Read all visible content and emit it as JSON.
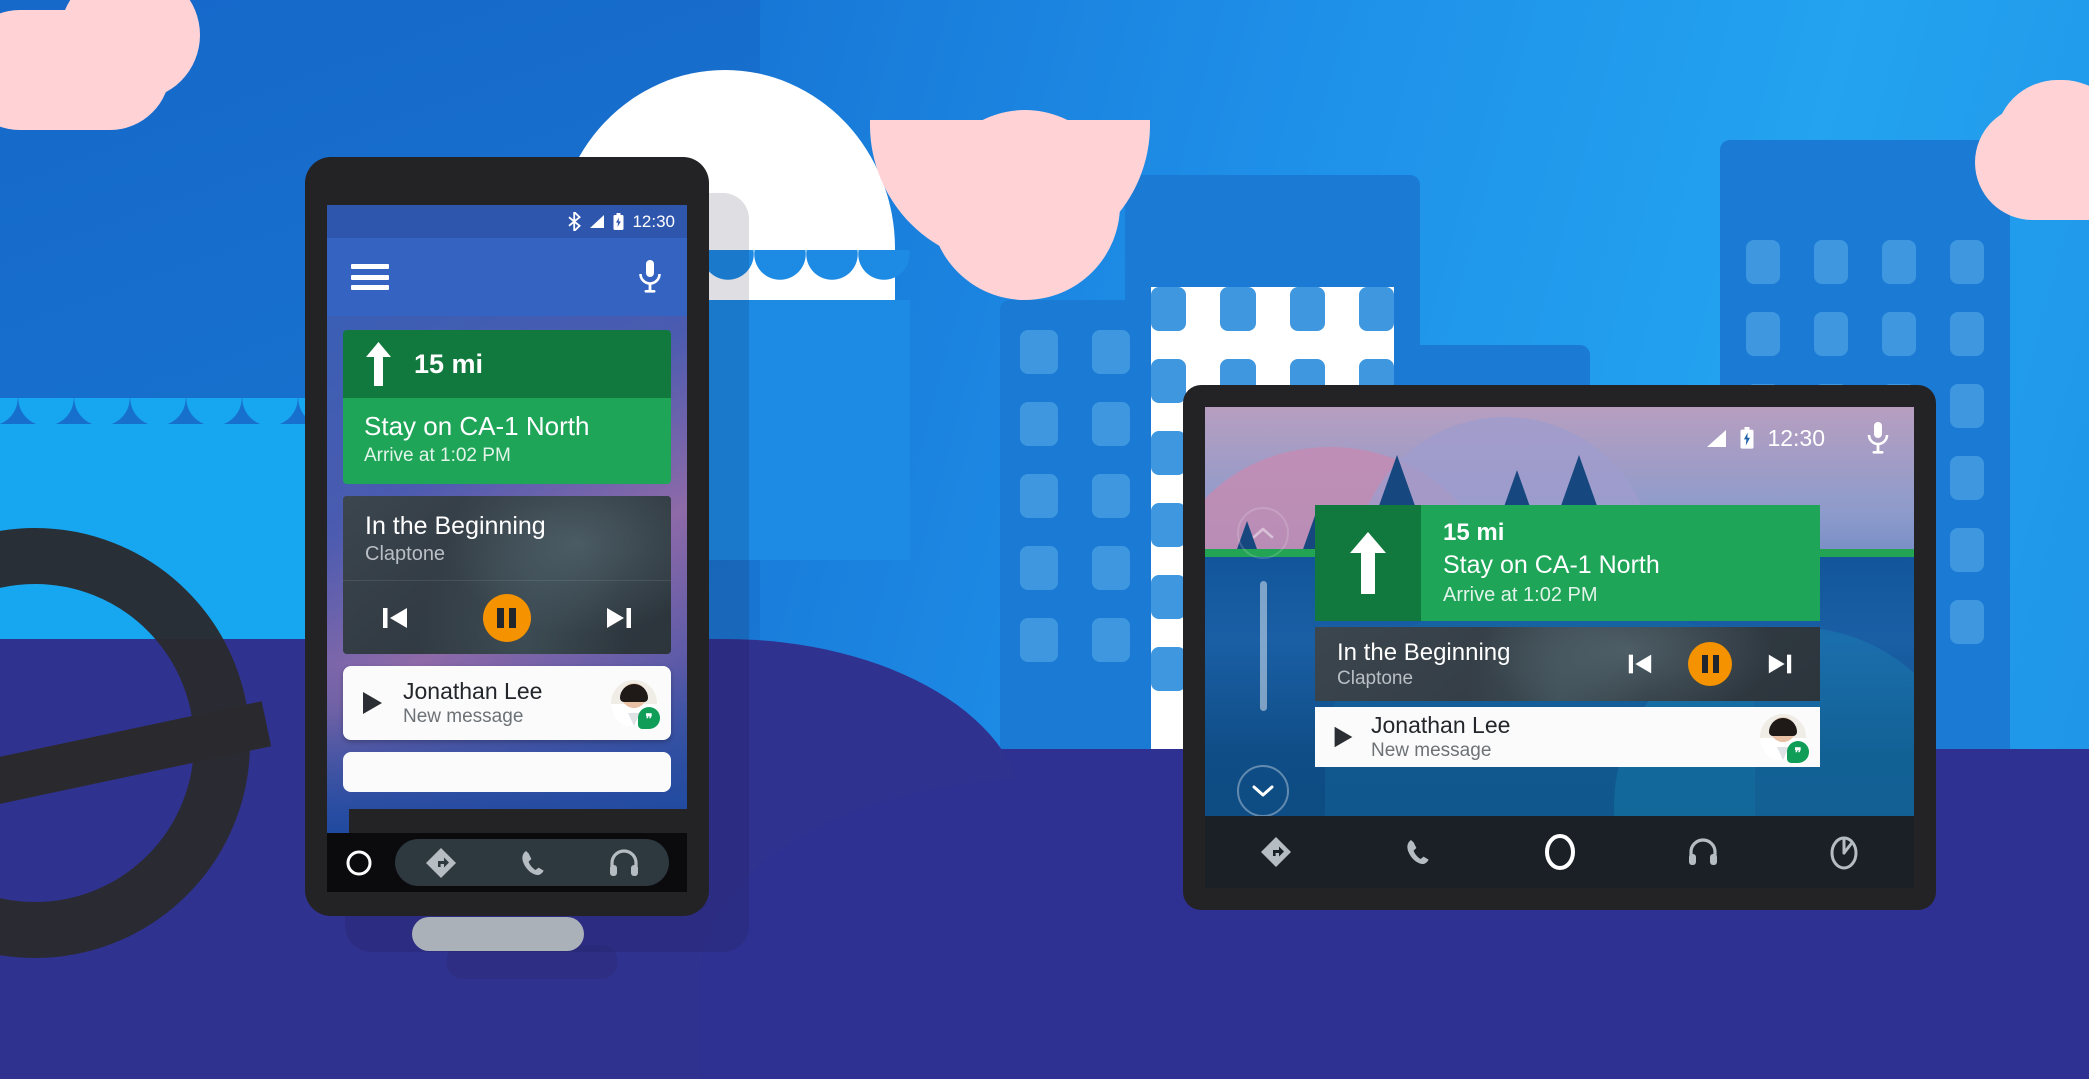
{
  "scene": {
    "title": "Android Auto on phone screen and car head unit",
    "colors": {
      "sky_blue": "#1e8fe8",
      "ground_navy": "#2f3192",
      "cloud_pink": "#ffd3d6",
      "nav_green_dark": "#12793e",
      "nav_green_light": "#1ea558",
      "media_gray": "#3c464e",
      "accent_orange": "#f59200",
      "hangouts_green": "#0f9d58",
      "phone_header_blue": "#3463c1"
    }
  },
  "phone": {
    "status_bar": {
      "bluetooth_icon": "bluetooth-icon",
      "signal_icon": "signal-icon",
      "battery_icon": "battery-icon",
      "time": "12:30"
    },
    "app_bar": {
      "menu_icon": "hamburger-menu-icon",
      "mic_icon": "microphone-icon"
    },
    "nav_card": {
      "maneuver_icon": "straight-arrow-icon",
      "distance": "15 mi",
      "instruction": "Stay on CA-1 North",
      "eta": "Arrive at 1:02 PM"
    },
    "media_card": {
      "track_title": "In the Beginning",
      "artist": "Claptone",
      "prev_icon": "skip-previous-icon",
      "pause_icon": "pause-icon",
      "next_icon": "skip-next-icon"
    },
    "message_card": {
      "play_icon": "play-icon",
      "sender": "Jonathan Lee",
      "subtitle": "New message",
      "avatar": "contact-avatar",
      "app_badge": "hangouts-badge-icon"
    },
    "nav_bar": {
      "home_icon": "home-circle-icon",
      "navigation_icon": "navigation-diamond-icon",
      "phone_icon": "phone-icon",
      "media_icon": "headphones-icon"
    }
  },
  "head_unit": {
    "status_bar": {
      "signal_icon": "signal-icon",
      "battery_icon": "battery-icon",
      "time": "12:30",
      "mic_icon": "microphone-icon"
    },
    "scroll": {
      "up_icon": "chevron-up-icon",
      "down_icon": "chevron-down-icon"
    },
    "nav_card": {
      "maneuver_icon": "straight-arrow-icon",
      "distance": "15 mi",
      "instruction": "Stay on CA-1 North",
      "eta": "Arrive at 1:02 PM"
    },
    "media_card": {
      "track_title": "In the Beginning",
      "artist": "Claptone",
      "prev_icon": "skip-previous-icon",
      "pause_icon": "pause-icon",
      "next_icon": "skip-next-icon"
    },
    "message_card": {
      "play_icon": "play-icon",
      "sender": "Jonathan Lee",
      "subtitle": "New message",
      "avatar": "contact-avatar",
      "app_badge": "hangouts-badge-icon"
    },
    "nav_bar": {
      "navigation_icon": "navigation-diamond-icon",
      "phone_icon": "phone-icon",
      "home_icon": "home-circle-icon",
      "media_icon": "headphones-icon",
      "car_icon": "car-apps-icon"
    }
  }
}
